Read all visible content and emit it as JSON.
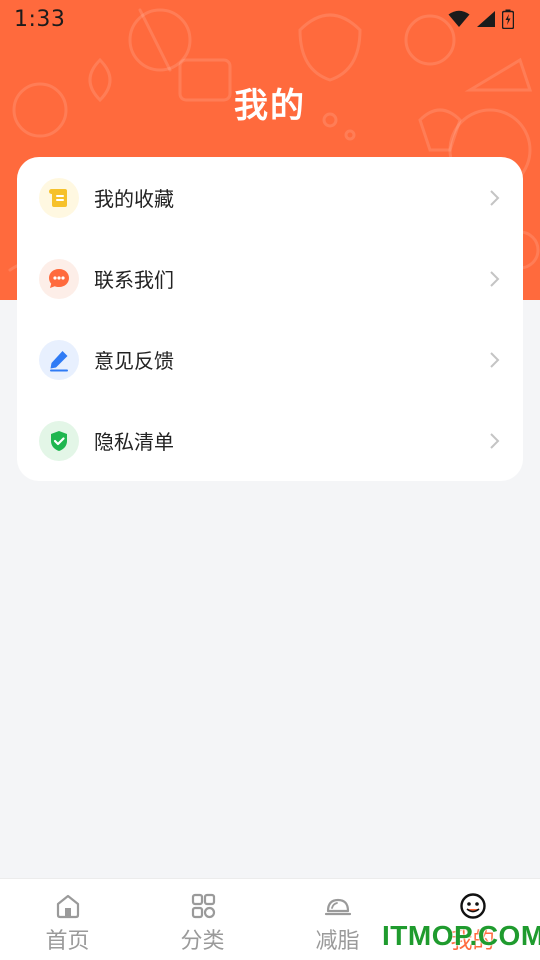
{
  "status_bar": {
    "time": "1:33"
  },
  "header": {
    "title": "我的"
  },
  "menu": {
    "items": [
      {
        "label": "我的收藏",
        "icon": "scroll-icon",
        "icon_bg": "#fff8e1",
        "icon_color": "#f6c12b"
      },
      {
        "label": "联系我们",
        "icon": "chat-bubble-icon",
        "icon_bg": "#fdeee8",
        "icon_color": "#ff6a3d"
      },
      {
        "label": "意见反馈",
        "icon": "pencil-icon",
        "icon_bg": "#e8f0fe",
        "icon_color": "#2f7bf5"
      },
      {
        "label": "隐私清单",
        "icon": "shield-check-icon",
        "icon_bg": "#e3f6e7",
        "icon_color": "#1fb64f"
      }
    ]
  },
  "tabbar": {
    "tabs": [
      {
        "label": "首页",
        "icon": "home-icon",
        "active": false
      },
      {
        "label": "分类",
        "icon": "grid-icon",
        "active": false
      },
      {
        "label": "减脂",
        "icon": "cloche-icon",
        "active": false
      },
      {
        "label": "我的",
        "icon": "face-icon",
        "active": true
      }
    ]
  },
  "watermark": "ITMOP.COM",
  "colors": {
    "accent": "#ff6a3d",
    "background": "#f4f5f7",
    "inactive_tab": "#9a9a9a"
  }
}
